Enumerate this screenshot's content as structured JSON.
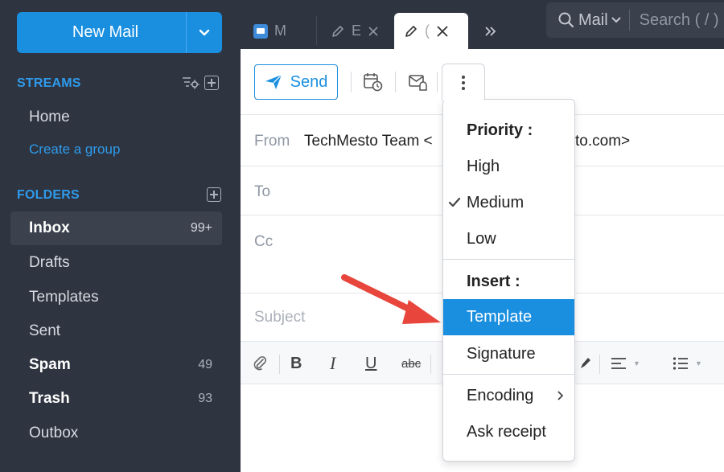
{
  "sidebar": {
    "new_mail_label": "New Mail",
    "streams": {
      "title": "STREAMS",
      "items": [
        {
          "label": "Home"
        },
        {
          "label": "Create a group"
        }
      ]
    },
    "folders": {
      "title": "FOLDERS",
      "items": [
        {
          "label": "Inbox",
          "count": "99+"
        },
        {
          "label": "Drafts",
          "count": ""
        },
        {
          "label": "Templates",
          "count": ""
        },
        {
          "label": "Sent",
          "count": ""
        },
        {
          "label": "Spam",
          "count": "49"
        },
        {
          "label": "Trash",
          "count": "93"
        },
        {
          "label": "Outbox",
          "count": ""
        }
      ]
    }
  },
  "topbar": {
    "tabs": [
      {
        "label": "M",
        "icon": "mail-icon"
      },
      {
        "label": "E",
        "icon": "pencil-icon"
      },
      {
        "label": "(",
        "icon": "pencil-icon"
      }
    ],
    "search": {
      "scope": "Mail",
      "placeholder": "Search ( / )"
    }
  },
  "compose": {
    "send_label": "Send",
    "from_label": "From",
    "from_value": "TechMesto Team <",
    "from_value_tail": "to.com>",
    "to_label": "To",
    "cc_label": "Cc",
    "subject_placeholder": "Subject"
  },
  "menu": {
    "priority_header": "Priority :",
    "priority_items": [
      {
        "label": "High",
        "checked": false
      },
      {
        "label": "Medium",
        "checked": true
      },
      {
        "label": "Low",
        "checked": false
      }
    ],
    "insert_header": "Insert :",
    "insert_items": [
      {
        "label": "Template",
        "highlighted": true
      },
      {
        "label": "Signature",
        "highlighted": false
      }
    ],
    "encoding_label": "Encoding",
    "ask_receipt_label": "Ask receipt"
  },
  "colors": {
    "accent": "#1a8fe0",
    "sidebar_bg": "#2e3440",
    "annotation_arrow": "#e8453c"
  }
}
